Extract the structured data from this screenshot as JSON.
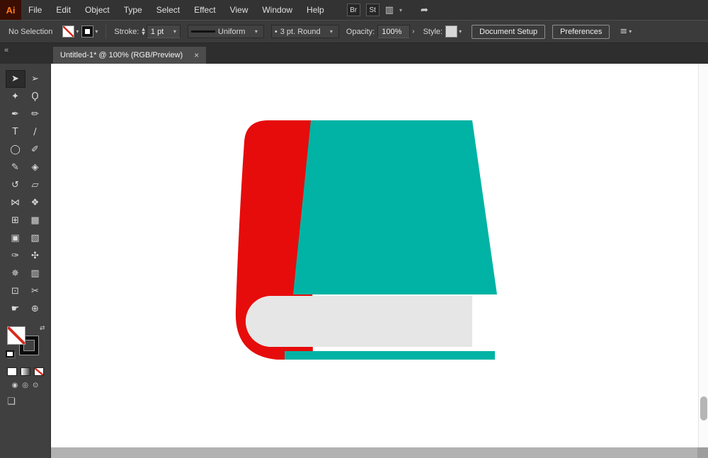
{
  "app": {
    "logo": "Ai"
  },
  "menubar": {
    "items": [
      "File",
      "Edit",
      "Object",
      "Type",
      "Select",
      "Effect",
      "View",
      "Window",
      "Help"
    ],
    "badges": [
      "Br",
      "St"
    ],
    "workspace_icon": "▥",
    "workspace_chevron": "▾",
    "share_icon": "➦"
  },
  "controlbar": {
    "selection_status": "No Selection",
    "fill_chevron": "▾",
    "stroke_chevron": "▾",
    "stroke_label": "Stroke:",
    "stepper_up": "▲",
    "stepper_down": "▼",
    "stroke_weight": "1 pt",
    "width_profile": "Uniform",
    "brush_bullet": "•",
    "brush_name": "3 pt. Round",
    "opacity_label": "Opacity:",
    "opacity_value": "100%",
    "next_glyph": "›",
    "style_label": "Style:",
    "document_setup": "Document Setup",
    "preferences": "Preferences",
    "align_icon": "≡",
    "combo_chevron": "▾"
  },
  "tabbar": {
    "collapse_glyph": "«",
    "tab_title": "Untitled-1* @ 100% (RGB/Preview)",
    "close_glyph": "×"
  },
  "toolbar": {
    "tools": [
      {
        "name": "selection",
        "glyph": "➤"
      },
      {
        "name": "direct-selection",
        "glyph": "➢"
      },
      {
        "name": "magic-wand",
        "glyph": "✦"
      },
      {
        "name": "lasso",
        "glyph": "Ϙ"
      },
      {
        "name": "pen",
        "glyph": "✒"
      },
      {
        "name": "curvature",
        "glyph": "✏"
      },
      {
        "name": "type",
        "glyph": "T"
      },
      {
        "name": "line-segment",
        "glyph": "∕"
      },
      {
        "name": "ellipse",
        "glyph": "◯"
      },
      {
        "name": "paintbrush",
        "glyph": "✐"
      },
      {
        "name": "pencil",
        "glyph": "✎"
      },
      {
        "name": "eraser",
        "glyph": "◈"
      },
      {
        "name": "rotate",
        "glyph": "↺"
      },
      {
        "name": "free-transform",
        "glyph": "▱"
      },
      {
        "name": "width",
        "glyph": "⋈"
      },
      {
        "name": "shape-builder",
        "glyph": "❖"
      },
      {
        "name": "perspective-grid",
        "glyph": "⊞"
      },
      {
        "name": "mesh",
        "glyph": "▦"
      },
      {
        "name": "image-frame",
        "glyph": "▣"
      },
      {
        "name": "gradient",
        "glyph": "▧"
      },
      {
        "name": "eyedropper",
        "glyph": "✑"
      },
      {
        "name": "blend",
        "glyph": "✣"
      },
      {
        "name": "symbol-sprayer",
        "glyph": "✵"
      },
      {
        "name": "column-graph",
        "glyph": "▥"
      },
      {
        "name": "artboard",
        "glyph": "⊡"
      },
      {
        "name": "slice",
        "glyph": "✂"
      },
      {
        "name": "hand",
        "glyph": "☛"
      },
      {
        "name": "zoom",
        "glyph": "⊕"
      }
    ],
    "swap_glyph": "⇄",
    "draw_modes": [
      "◉",
      "◎",
      "⊙"
    ],
    "screen_mode_glyph": "❏"
  },
  "canvas": {
    "book": {
      "spine_color": "#e60c0c",
      "cover_color": "#00b3a4",
      "pages_color": "#e6e6e6",
      "page_edge_color": "#ffffff",
      "bottom_board_color": "#00b3a4"
    }
  }
}
